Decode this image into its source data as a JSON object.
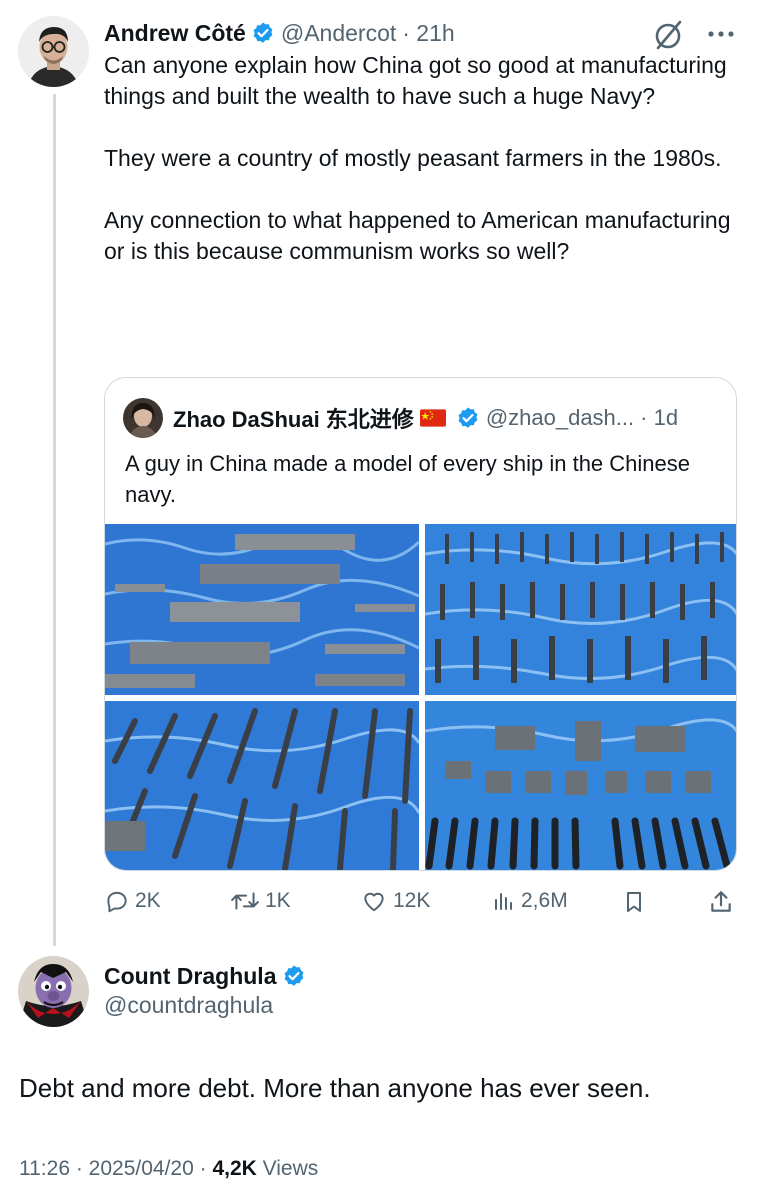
{
  "tweet": {
    "author_name": "Andrew Côté",
    "handle": "@Andercot",
    "time": "· 21h",
    "text": "Can anyone explain how China got so good at manufacturing things and built the wealth to have such a huge Navy?\n\nThey were a country of mostly peasant farmers in the 1980s.\n\nAny connection to what happened to American manufacturing or is this because communism works so well?",
    "more_icon": "ellipsis-icon",
    "grok_icon": "grok-icon"
  },
  "quote": {
    "author_name": "Zhao DaShuai 东北进修",
    "handle": "@zhao_dash...",
    "time": "· 1d",
    "text": "A guy in China made a model of every ship in the Chinese navy."
  },
  "actions": {
    "replies": "2K",
    "reposts": "1K",
    "likes": "12K",
    "views": "2,6M"
  },
  "reply": {
    "author_name": "Count Draghula",
    "handle": "@countdraghula",
    "text": "Debt and more debt. More than anyone has ever seen.",
    "timestamp": "11:26 · 2025/04/20 ·",
    "views_count": "4,2K",
    "views_label": "Views"
  },
  "colors": {
    "verified_blue": "#1d9bf0",
    "muted_text": "#536471",
    "border": "#cfd9de",
    "water": "#3b7fd6"
  }
}
